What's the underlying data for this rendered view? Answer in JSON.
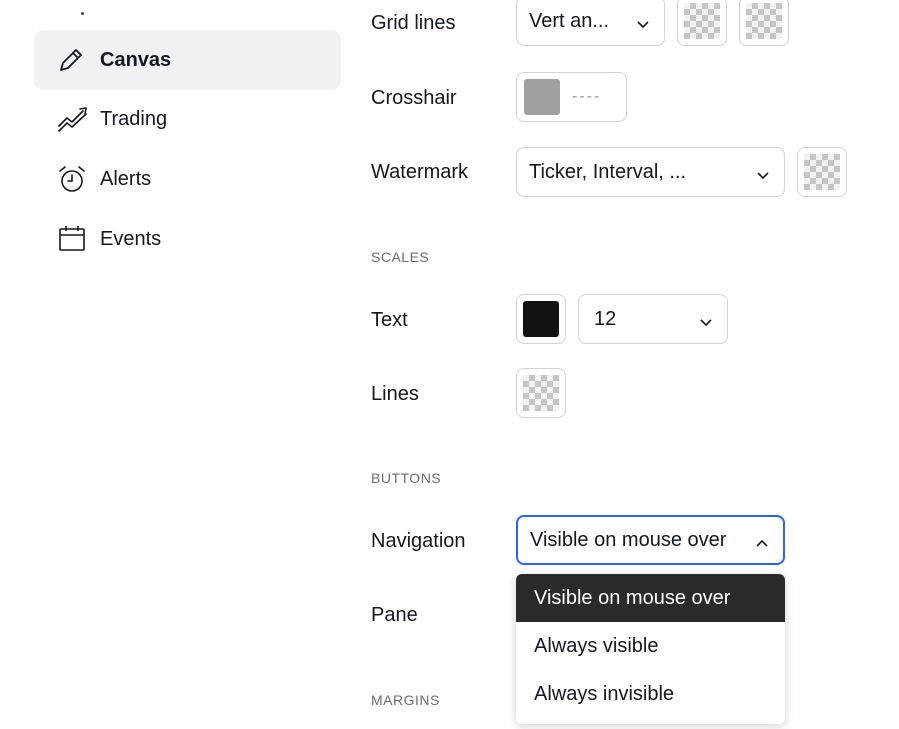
{
  "sidebar": {
    "items": [
      {
        "label": "Canvas",
        "icon": "pencil-icon",
        "active": true
      },
      {
        "label": "Trading",
        "icon": "trading-icon",
        "active": false
      },
      {
        "label": "Alerts",
        "icon": "alarm-clock-icon",
        "active": false
      },
      {
        "label": "Events",
        "icon": "calendar-icon",
        "active": false
      }
    ]
  },
  "canvas": {
    "grid_lines": {
      "label": "Grid lines",
      "value": "Vert an..."
    },
    "crosshair": {
      "label": "Crosshair",
      "line_style": "----",
      "color": "#a0a0a0"
    },
    "watermark": {
      "label": "Watermark",
      "value": "Ticker, Interval, ..."
    }
  },
  "scales": {
    "section": "SCALES",
    "text": {
      "label": "Text",
      "color": "#111111",
      "font_size": "12"
    },
    "lines": {
      "label": "Lines"
    }
  },
  "buttons": {
    "section": "BUTTONS",
    "navigation": {
      "label": "Navigation",
      "value": "Visible on mouse over"
    },
    "pane": {
      "label": "Pane"
    },
    "navigation_options": [
      "Visible on mouse over",
      "Always visible",
      "Always invisible"
    ]
  },
  "margins": {
    "section": "MARGINS"
  },
  "colors": {
    "accent": "#2962ff",
    "selected_option_bg": "#2a2a2c",
    "active_item_bg": "#f0f1f3"
  }
}
